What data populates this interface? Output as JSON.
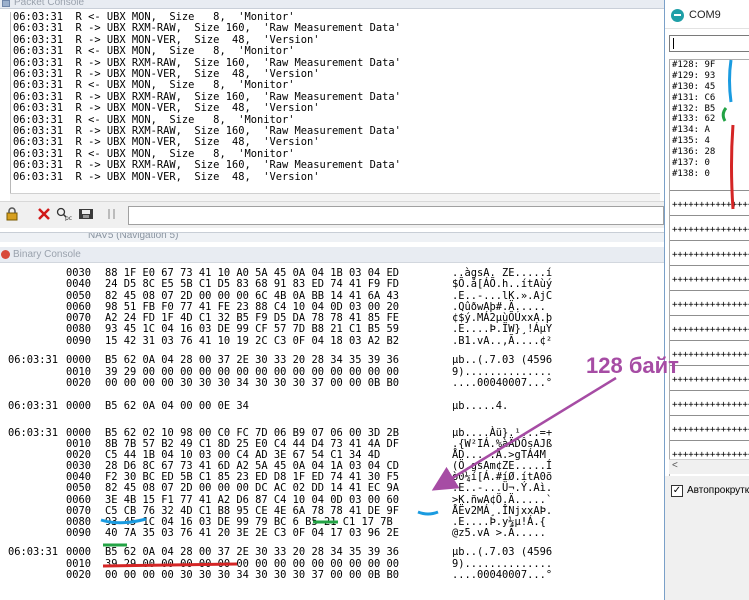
{
  "packet_console": {
    "title": "Packet Console",
    "log": [
      "06:03:31  R <- UBX MON,  Size   8,  'Monitor'",
      "06:03:31  R -> UBX RXM-RAW,  Size 160,  'Raw Measurement Data'",
      "06:03:31  R -> UBX MON-VER,  Size  48,  'Version'",
      "06:03:31  R <- UBX MON,  Size   8,  'Monitor'",
      "06:03:31  R -> UBX RXM-RAW,  Size 160,  'Raw Measurement Data'",
      "06:03:31  R -> UBX MON-VER,  Size  48,  'Version'",
      "06:03:31  R <- UBX MON,  Size   8,  'Monitor'",
      "06:03:31  R -> UBX RXM-RAW,  Size 160,  'Raw Measurement Data'",
      "06:03:31  R -> UBX MON-VER,  Size  48,  'Version'",
      "06:03:31  R <- UBX MON,  Size   8,  'Monitor'",
      "06:03:31  R -> UBX RXM-RAW,  Size 160,  'Raw Measurement Data'",
      "06:03:31  R -> UBX MON-VER,  Size  48,  'Version'",
      "06:03:31  R <- UBX MON,  Size   8,  'Monitor'",
      "06:03:31  R -> UBX RXM-RAW,  Size 160,  'Raw Measurement Data'",
      "06:03:31  R -> UBX MON-VER,  Size  48,  'Version'"
    ]
  },
  "nav5_tab": {
    "title": "NAV5 (Navigation 5)"
  },
  "binary_console": {
    "title": "Binary Console",
    "rows": [
      {
        "time": "",
        "off": "0030",
        "hex": "88 1F E0 67 73 41 10 A0 5A 45 0A 04 1B 03 04 ED",
        "ascii": "..àgsA. ZE.....í"
      },
      {
        "time": "",
        "off": "0040",
        "hex": "24 D5 8C E5 5B C1 D5 83 68 91 83 ED 74 41 F9 FD",
        "ascii": "$Õ.å[ÁÕ.h..ítAùý"
      },
      {
        "time": "",
        "off": "0050",
        "hex": "82 45 08 07 2D 00 00 00 6C 4B 0A BB 14 41 6A 43",
        "ascii": ".E..-...lK.».AjC"
      },
      {
        "time": "",
        "off": "0060",
        "hex": "98 51 FB F0 77 41 FE 23 88 C4 10 04 0D 03 00 20",
        "ascii": ".QûðwAþ#.Ä..... "
      },
      {
        "time": "",
        "off": "0070",
        "hex": "A2 24 FD 1F 4D C1 32 B5 F9 D5 DA 78 78 41 85 FE",
        "ascii": "¢$ý.MÁ2µùÕÚxxA.þ"
      },
      {
        "time": "",
        "off": "0080",
        "hex": "93 45 1C 04 16 03 DE 99 CF 57 7D B8 21 C1 B5 59",
        "ascii": ".E....Þ.ÏW}¸!ÁµY"
      },
      {
        "time": "",
        "off": "0090",
        "hex": "15 42 31 03 76 41 10 19 2C C3 0F 04 18 03 A2 B2",
        "ascii": ".B1.vA..,Ã....¢²"
      },
      {
        "time": "06:03:31",
        "off": "0000",
        "hex": "B5 62 0A 04 28 00 37 2E 30 33 20 28 34 35 39 36",
        "ascii": "µb..(.7.03 (4596"
      },
      {
        "time": "",
        "off": "0010",
        "hex": "39 29 00 00 00 00 00 00 00 00 00 00 00 00 00 00",
        "ascii": "9).............."
      },
      {
        "time": "",
        "off": "0020",
        "hex": "00 00 00 00 30 30 30 34 30 30 30 37 00 00 0B B0",
        "ascii": "....00040007...°"
      },
      {
        "time": "06:03:31",
        "off": "0000",
        "hex": "B5 62 0A 04 00 00 0E 34",
        "ascii": "µb.....4."
      },
      {
        "time": "06:03:31",
        "off": "0000",
        "hex": "B5 62 02 10 98 00 C0 FC 7D 06 B9 07 06 00 3D 2B",
        "ascii": "µb....Àü}.¹...=+"
      },
      {
        "time": "",
        "off": "0010",
        "hex": "8B 7B 57 B2 49 C1 8D 25 E0 C4 44 D4 73 41 4A DF",
        "ascii": ".{W²IÁ.%àÄDÔsAJß"
      },
      {
        "time": "",
        "off": "0020",
        "hex": "C5 44 1B 04 10 03 00 C4 AD 3E 67 54 C1 34 4D",
        "ascii": "ÅD.....Ä.>gTÁ4M"
      },
      {
        "time": "",
        "off": "0030",
        "hex": "28 D6 8C 67 73 41 6D A2 5A 45 0A 04 1A 03 04 CD",
        "ascii": "(Ö.gsAm¢ZE.....Í"
      },
      {
        "time": "",
        "off": "0040",
        "hex": "F2 30 BC ED 5B C1 85 23 ED D8 1F ED 74 41 30 F5",
        "ascii": "ò0¼í[Á.#íØ.ítA0õ"
      },
      {
        "time": "",
        "off": "0050",
        "hex": "82 45 08 07 2D 00 00 00 DC AC 02 DD 14 41 EC 9A",
        "ascii": ".E..-...Ü¬.Ý.Aì."
      },
      {
        "time": "",
        "off": "0060",
        "hex": "3E 4B 15 F1 77 41 A2 D6 87 C4 10 04 0D 03 00 60",
        "ascii": ">K.ñwA¢Ö.Ä.....`"
      },
      {
        "time": "",
        "off": "0070",
        "hex": "C5 CB 76 32 4D C1 B8 95 CE 4E 6A 78 78 41 DE 9F",
        "ascii": "ÅËv2MÁ¸.ÎNjxxAÞ."
      },
      {
        "time": "",
        "off": "0080",
        "hex": "93 45 1C 04 16 03 DE 99 79 BC 6 B5 21 C1 17 7B",
        "ascii": ".E....Þ.y¼µ!Á.{"
      },
      {
        "time": "",
        "off": "0090",
        "hex": "40 7A 35 03 76 41 20 3E 2E C3 0F 04 17 03 96 2E",
        "ascii": "@z5.vA >.Ã....."
      },
      {
        "time": "06:03:31",
        "off": "0000",
        "hex": "B5 62 0A 04 28 00 37 2E 30 33 20 28 34 35 39 36",
        "ascii": "µb..(.7.03 (4596"
      },
      {
        "time": "",
        "off": "0010",
        "hex": "39 29 00 00 00 00 00 00 00 00 00 00 00 00 00 00",
        "ascii": "9).............."
      },
      {
        "time": "",
        "off": "0020",
        "hex": "00 00 00 00 30 30 30 34 30 30 30 37 00 00 0B B0",
        "ascii": "....00040007...°"
      }
    ]
  },
  "com9": {
    "title": "COM9",
    "lines": [
      "#128: 9F",
      "#129: 93",
      "#130: 45",
      "#131: C6",
      "#132: B5",
      "#133: 62",
      "#134: A",
      "#135: 4",
      "#136: 28",
      "#137: 0",
      "#138: 0"
    ],
    "plus_line": "+++++++++++++++++++++",
    "autoscroll_label": "Автопрокрутка",
    "autoscroll_mark": "✓"
  },
  "annotation": {
    "label": "128 байт"
  },
  "colors": {
    "blue_mark": "#1a9be0",
    "green_mark": "#23a345",
    "red_mark": "#d42525",
    "arrow": "#a64ca4"
  },
  "icons": [
    "lock-icon",
    "delete-icon",
    "filter-icon",
    "save-icon",
    "pause-icon",
    "com9-logo-icon",
    "scroll-left-icon",
    "binary-console-icon",
    "packet-console-icon"
  ]
}
